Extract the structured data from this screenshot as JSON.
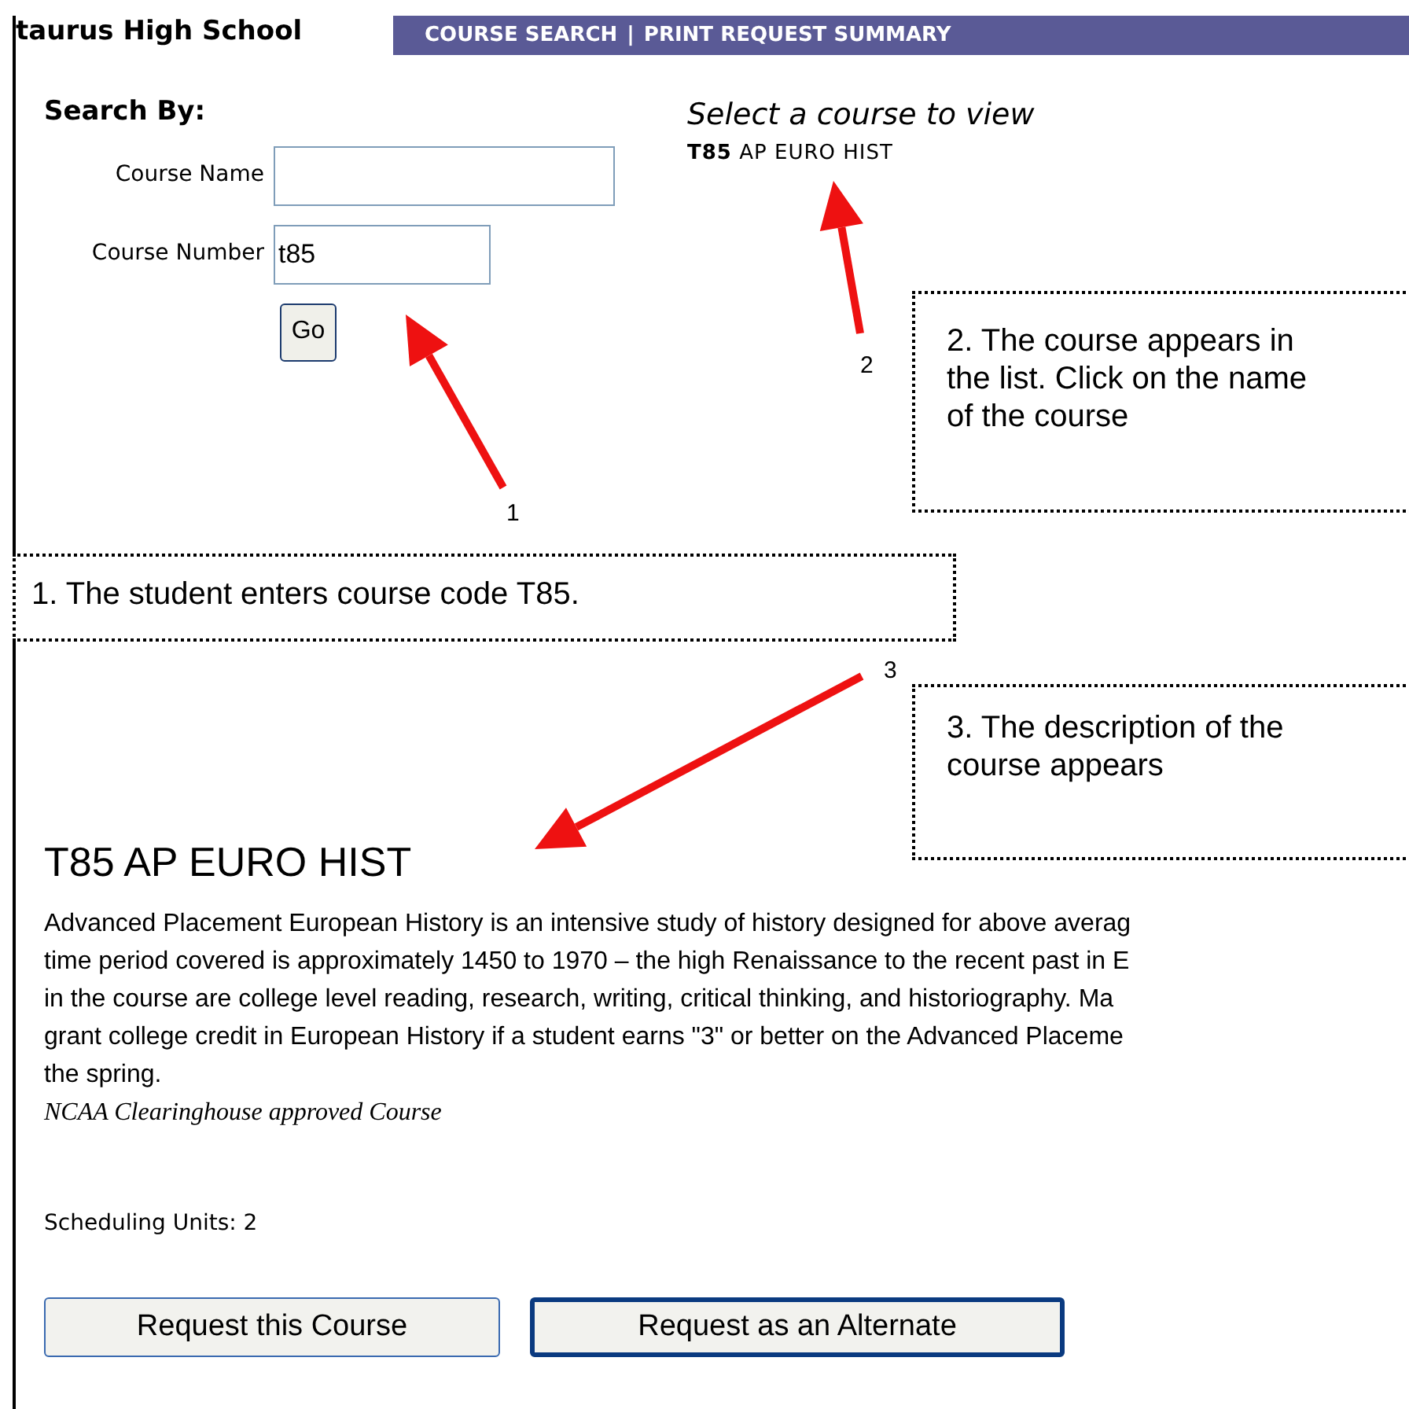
{
  "header": {
    "school_tab": "taurus High School",
    "nav": [
      {
        "label": "COURSE SEARCH"
      },
      {
        "label": "PRINT REQUEST SUMMARY"
      }
    ],
    "separator": "|"
  },
  "search": {
    "heading": "Search By:",
    "fields": [
      {
        "label": "Course Name"
      },
      {
        "label": "Course Number",
        "value": "t85"
      }
    ],
    "go_button": "Go"
  },
  "results": {
    "heading": "Select a course to view",
    "items": [
      {
        "code": "T85",
        "name": "AP EURO HIST"
      }
    ]
  },
  "course": {
    "title": "T85 AP EURO HIST",
    "description_lines": [
      "Advanced Placement European History is an intensive study of history designed for above averag",
      "time period covered is approximately 1450 to 1970 – the high Renaissance to the recent past in E",
      "in the course are college level reading, research, writing, critical thinking, and historiography.  Ma",
      "grant college credit in European History if a student earns \"3\" or better on the Advanced Placeme",
      "the spring."
    ],
    "note": "NCAA Clearinghouse approved Course",
    "units": "Scheduling Units: 2",
    "buttons": [
      {
        "label": "Request this Course",
        "focused": false
      },
      {
        "label": "Request as an Alternate",
        "focused": true
      }
    ]
  },
  "annotations": [
    {
      "number": "1",
      "text": "1.  The student enters course code T85."
    },
    {
      "number": "2",
      "text": "2. The course appears in the list.  Click on the name of the course"
    },
    {
      "number": "3",
      "text": "3.  The description of the course appears"
    }
  ]
}
